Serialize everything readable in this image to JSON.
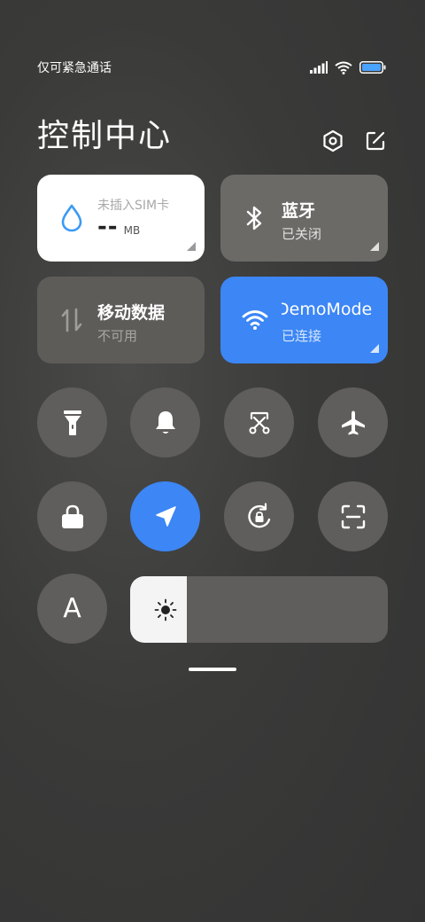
{
  "status_bar": {
    "carrier": "仅可紧急通话",
    "icons": [
      "signal-icon",
      "wifi-icon",
      "battery-icon"
    ]
  },
  "header": {
    "title": "控制中心",
    "actions": [
      "settings-icon",
      "edit-icon"
    ]
  },
  "tiles": {
    "data_usage": {
      "sub": "未插入SIM卡",
      "value": "--",
      "unit": "MB",
      "icon": "water-drop-icon"
    },
    "bluetooth": {
      "title": "蓝牙",
      "status": "已关闭",
      "icon": "bluetooth-icon"
    },
    "mobile_data": {
      "title": "移动数据",
      "status": "不可用",
      "icon": "mobile-data-icon"
    },
    "wifi": {
      "title": "DemoMode",
      "status": "已连接",
      "icon": "wifi-icon"
    }
  },
  "toggles": [
    {
      "name": "flashlight",
      "icon": "flashlight-icon",
      "active": false
    },
    {
      "name": "mute",
      "icon": "bell-icon",
      "active": false
    },
    {
      "name": "screenshot",
      "icon": "scissors-icon",
      "active": false
    },
    {
      "name": "airplane",
      "icon": "airplane-icon",
      "active": false
    },
    {
      "name": "lock",
      "icon": "lock-icon",
      "active": false
    },
    {
      "name": "location",
      "icon": "location-arrow-icon",
      "active": true
    },
    {
      "name": "rotation-lock",
      "icon": "rotation-lock-icon",
      "active": false
    },
    {
      "name": "scanner",
      "icon": "scan-icon",
      "active": false
    },
    {
      "name": "font",
      "icon": "font-icon",
      "active": false
    }
  ],
  "font_toggle_label": "A",
  "brightness": {
    "level": 0.22,
    "icon": "sun-icon"
  },
  "colors": {
    "accent": "#3c86f5",
    "tile_inactive": "#5f5e5c",
    "background": "#3a3a39"
  }
}
